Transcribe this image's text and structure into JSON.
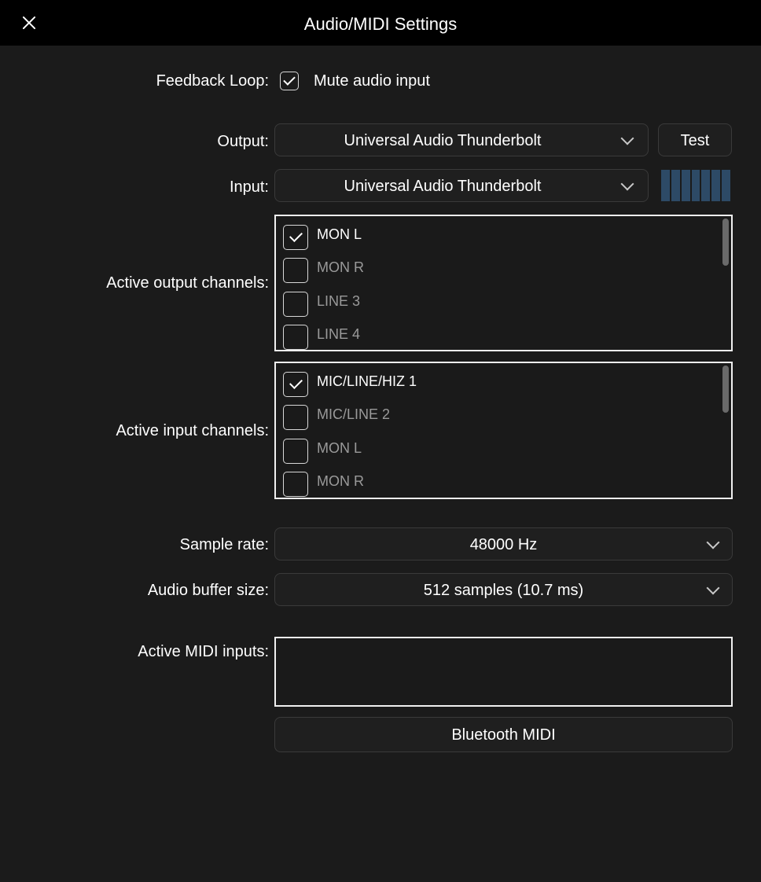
{
  "window": {
    "title": "Audio/MIDI Settings"
  },
  "feedback_loop": {
    "label": "Feedback Loop:",
    "checkbox_label": "Mute audio input",
    "checked": true
  },
  "output": {
    "label": "Output:",
    "value": "Universal Audio Thunderbolt",
    "test_label": "Test"
  },
  "input": {
    "label": "Input:",
    "value": "Universal Audio Thunderbolt",
    "level": 0
  },
  "active_output_channels": {
    "label": "Active output channels:",
    "items": [
      {
        "label": "MON L",
        "checked": true
      },
      {
        "label": "MON R",
        "checked": false
      },
      {
        "label": "LINE 3",
        "checked": false
      },
      {
        "label": "LINE 4",
        "checked": false
      }
    ]
  },
  "active_input_channels": {
    "label": "Active input channels:",
    "items": [
      {
        "label": "MIC/LINE/HIZ 1",
        "checked": true
      },
      {
        "label": "MIC/LINE 2",
        "checked": false
      },
      {
        "label": "MON L",
        "checked": false
      },
      {
        "label": "MON R",
        "checked": false
      }
    ]
  },
  "sample_rate": {
    "label": "Sample rate:",
    "value": "48000 Hz"
  },
  "buffer_size": {
    "label": "Audio buffer size:",
    "value": "512 samples (10.7 ms)"
  },
  "midi_inputs": {
    "label": "Active MIDI inputs:",
    "items": []
  },
  "bluetooth_midi": {
    "label": "Bluetooth MIDI"
  },
  "colors": {
    "background": "#1b1b1b",
    "titlebar": "#000000",
    "meter": "#2d4a66",
    "text": "#ffffff",
    "muted_text": "#9a9a9a"
  }
}
